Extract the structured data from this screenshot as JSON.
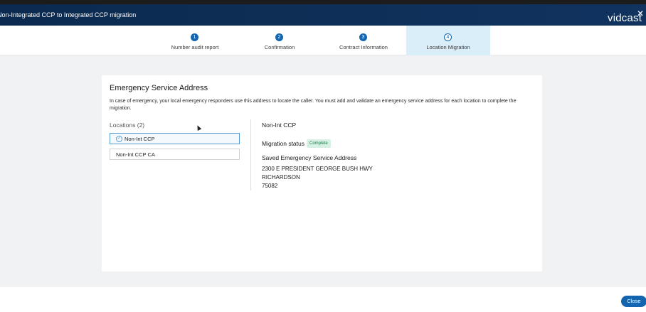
{
  "window": {
    "title": "Non-Integrated CCP to Integrated CCP migration",
    "brand": "vidcast",
    "close_glyph": "✕"
  },
  "stepper": {
    "steps": [
      {
        "number": "1",
        "label": "Number audit report"
      },
      {
        "number": "2",
        "label": "Confirmation"
      },
      {
        "number": "3",
        "label": "Contract Information"
      },
      {
        "number": "4",
        "label": "Location Migration"
      }
    ],
    "active_step": 4
  },
  "card": {
    "title": "Emergency Service Address",
    "description": "In case of emergency, your local emergency responders use this address to locate the caller. You must add and validate an emergency service address for each location to complete the migration."
  },
  "locations": {
    "heading": "Locations (2)",
    "items": [
      {
        "label": "Non-Int CCP",
        "selected": true,
        "icon": "check-circle-icon"
      },
      {
        "label": "Non-Int CCP CA",
        "selected": false
      }
    ]
  },
  "detail": {
    "title": "Non-Int CCP",
    "status_label": "Migration status :",
    "status_value": "Complete",
    "saved_title": "Saved Emergency Service Address",
    "address_lines": [
      "2300 E PRESIDENT GEORGE BUSH HWY",
      "RICHARDSON",
      "75082"
    ]
  },
  "footer": {
    "close_label": "Close"
  },
  "colors": {
    "header": "#0c2a4f",
    "accent": "#1365b0",
    "active_step_bg": "#daeef9",
    "status_badge_bg": "#d6f1e3",
    "status_badge_text": "#1c7a4a"
  }
}
